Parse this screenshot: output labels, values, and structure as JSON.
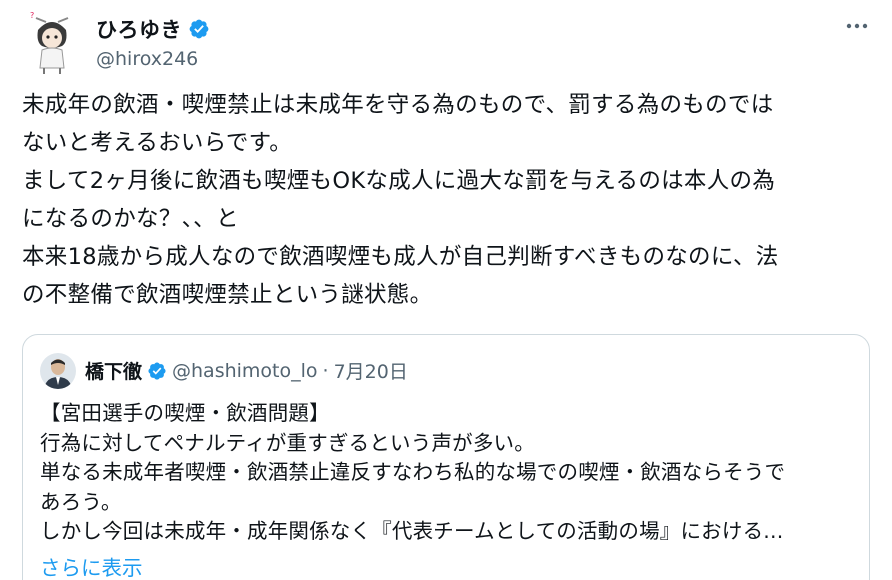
{
  "author": {
    "display_name": "ひろゆき",
    "handle": "@hirox246"
  },
  "tweet": {
    "text": "未成年の飲酒・喫煙禁止は未成年を守る為のもので、罰する為のものでは\nないと考えるおいらです。\nまして2ヶ月後に飲酒も喫煙もOKな成人に過大な罰を与えるのは本人の為\nになるのかな？、、と\n本来18歳から成人なので飲酒喫煙も成人が自己判断すべきものなのに、法\nの不整備で飲酒喫煙禁止という謎状態。"
  },
  "quote": {
    "display_name": "橋下徹",
    "handle": "@hashimoto_lo",
    "separator": "·",
    "date": "7月20日",
    "text": "【宮田選手の喫煙・飲酒問題】\n行為に対してペナルティが重すぎるという声が多い。\n単なる未成年者喫煙・飲酒禁止違反すなわち私的な場での喫煙・飲酒ならそうで\nあろう。\nしかし今回は未成年・成年関係なく『代表チームとしての活動の場』における...",
    "show_more": "さらに表示"
  },
  "colors": {
    "text": "#0f1419",
    "secondary": "#536471",
    "accent": "#1d9bf0",
    "border": "#cfd9de"
  },
  "icons": {
    "verified": "verified-badge-icon",
    "more": "more-options-icon"
  }
}
